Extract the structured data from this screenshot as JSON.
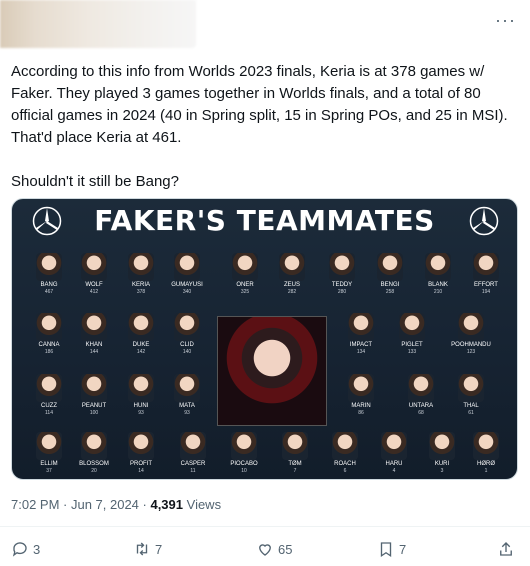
{
  "tweet": {
    "text": "According to this info from Worlds 2023 finals, Keria is at 378 games w/ Faker. They played 3 games together in Worlds finals, and a total of 80 official games in 2024 (40 in Spring split, 15 in Spring POs, and 25 in MSI). That'd place Keria at 461.\n\nShouldn't it still be Bang?",
    "timestamp": "7:02 PM · Jun 7, 2024 · ",
    "views_count": "4,391",
    "views_label": " Views"
  },
  "media": {
    "title": "FAKER'S TEAMMATES",
    "players": [
      {
        "name": "BANG",
        "count": "467"
      },
      {
        "name": "WOLF",
        "count": "412"
      },
      {
        "name": "KERIA",
        "count": "378"
      },
      {
        "name": "GUMAYUSI",
        "count": "340"
      },
      {
        "name": "ONER",
        "count": "325"
      },
      {
        "name": "ZEUS",
        "count": "282"
      },
      {
        "name": "TEDDY",
        "count": "280"
      },
      {
        "name": "BENGI",
        "count": "258"
      },
      {
        "name": "BLANK",
        "count": "210"
      },
      {
        "name": "EFFORT",
        "count": "194"
      },
      {
        "name": "CANNA",
        "count": "186"
      },
      {
        "name": "KHAN",
        "count": "144"
      },
      {
        "name": "DUKE",
        "count": "142"
      },
      {
        "name": "CLID",
        "count": "140"
      },
      {
        "name": "IMPACT",
        "count": "134"
      },
      {
        "name": "PIGLET",
        "count": "133"
      },
      {
        "name": "POOHMANDU",
        "count": "123"
      },
      {
        "name": "CUZZ",
        "count": "114"
      },
      {
        "name": "PEANUT",
        "count": "100"
      },
      {
        "name": "HUNI",
        "count": "93"
      },
      {
        "name": "MATA",
        "count": "93"
      },
      {
        "name": "MARIN",
        "count": "86"
      },
      {
        "name": "UNTARA",
        "count": "68"
      },
      {
        "name": "THAL",
        "count": "61"
      },
      {
        "name": "ELLIM",
        "count": "37"
      },
      {
        "name": "BLOSSOM",
        "count": "20"
      },
      {
        "name": "PROFIT",
        "count": "14"
      },
      {
        "name": "CASPER",
        "count": "11"
      },
      {
        "name": "PIOCABO",
        "count": "10"
      },
      {
        "name": "TØM",
        "count": "7"
      },
      {
        "name": "ROACH",
        "count": "6"
      },
      {
        "name": "HARU",
        "count": "4"
      },
      {
        "name": "KURI",
        "count": "3"
      },
      {
        "name": "HØRØ",
        "count": "1"
      }
    ]
  },
  "actions": {
    "replies": "3",
    "retweets": "7",
    "likes": "65",
    "bookmarks": "7"
  },
  "icons": {
    "more": "more-icon",
    "reply": "reply-icon",
    "retweet": "retweet-icon",
    "like": "like-icon",
    "bookmark": "bookmark-icon",
    "share": "share-icon"
  }
}
